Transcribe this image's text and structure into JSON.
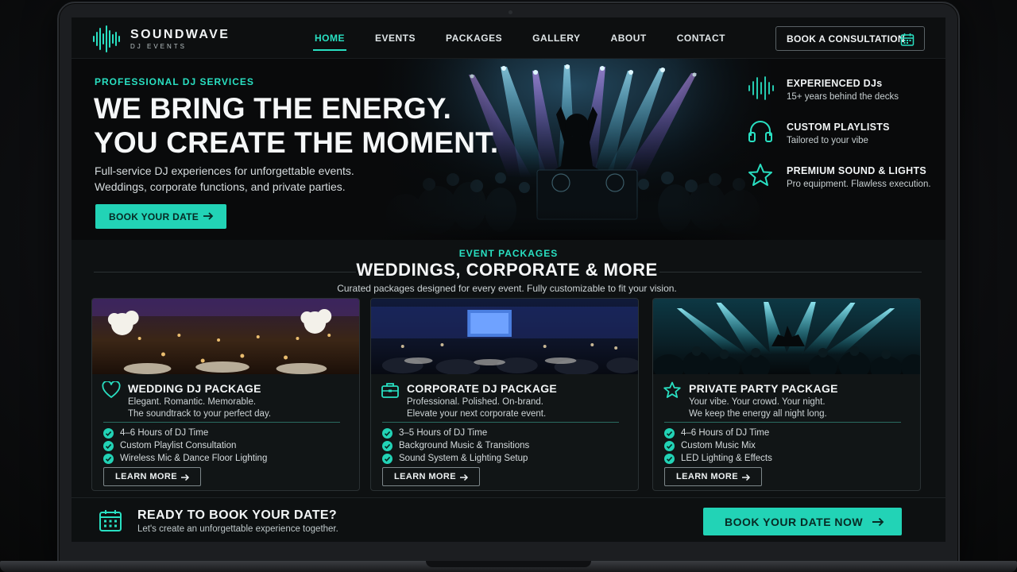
{
  "brand": {
    "name": "SOUNDWAVE",
    "tagline": "DJ EVENTS"
  },
  "nav": {
    "items": [
      {
        "label": "HOME",
        "active": true
      },
      {
        "label": "EVENTS"
      },
      {
        "label": "PACKAGES"
      },
      {
        "label": "GALLERY"
      },
      {
        "label": "ABOUT"
      },
      {
        "label": "CONTACT"
      }
    ],
    "consult_label": "BOOK A CONSULTATION",
    "consult_icon": "calendar-icon"
  },
  "hero": {
    "eyebrow": "PROFESSIONAL DJ SERVICES",
    "headline_line1": "WE BRING THE ENERGY.",
    "headline_line2": "YOU CREATE THE MOMENT.",
    "desc_line1": "Full-service DJ experiences for unforgettable events.",
    "desc_line2": "Weddings, corporate functions, and private parties.",
    "cta_label": "BOOK YOUR DATE",
    "features": [
      {
        "icon": "soundwave-icon",
        "title": "EXPERIENCED DJs",
        "sub": "15+ years behind the decks"
      },
      {
        "icon": "headphones-icon",
        "title": "CUSTOM PLAYLISTS",
        "sub": "Tailored to your vibe"
      },
      {
        "icon": "star-icon",
        "title": "PREMIUM SOUND & LIGHTS",
        "sub": "Pro equipment. Flawless execution."
      }
    ]
  },
  "packages": {
    "eyebrow": "EVENT PACKAGES",
    "title": "WEDDINGS, CORPORATE & MORE",
    "subtitle": "Curated packages designed for every event. Fully customizable to fit your vision.",
    "cards": [
      {
        "icon": "heart-icon",
        "title": "WEDDING DJ PACKAGE",
        "tag1": "Elegant. Romantic. Memorable.",
        "tag2": "The soundtrack to your perfect day.",
        "features": [
          "4–6 Hours of DJ Time",
          "Custom Playlist Consultation",
          "Wireless Mic & Dance Floor Lighting"
        ],
        "button": "LEARN MORE"
      },
      {
        "icon": "briefcase-icon",
        "title": "CORPORATE DJ PACKAGE",
        "tag1": "Professional. Polished. On-brand.",
        "tag2": "Elevate your next corporate event.",
        "features": [
          "3–5 Hours of DJ Time",
          "Background Music & Transitions",
          "Sound System & Lighting Setup"
        ],
        "button": "LEARN MORE"
      },
      {
        "icon": "star-icon",
        "title": "PRIVATE PARTY PACKAGE",
        "tag1": "Your vibe. Your crowd. Your night.",
        "tag2": "We keep the energy all night long.",
        "features": [
          "4–6 Hours of DJ Time",
          "Custom Music Mix",
          "LED Lighting & Effects"
        ],
        "button": "LEARN MORE"
      }
    ]
  },
  "bottom_cta": {
    "title": "READY TO BOOK YOUR DATE?",
    "subtitle": "Let's create an unforgettable experience together.",
    "button": "BOOK YOUR DATE NOW"
  },
  "colors": {
    "accent": "#22d3b6",
    "accent_text": "#29e0c2",
    "background": "#0b0d0e"
  }
}
